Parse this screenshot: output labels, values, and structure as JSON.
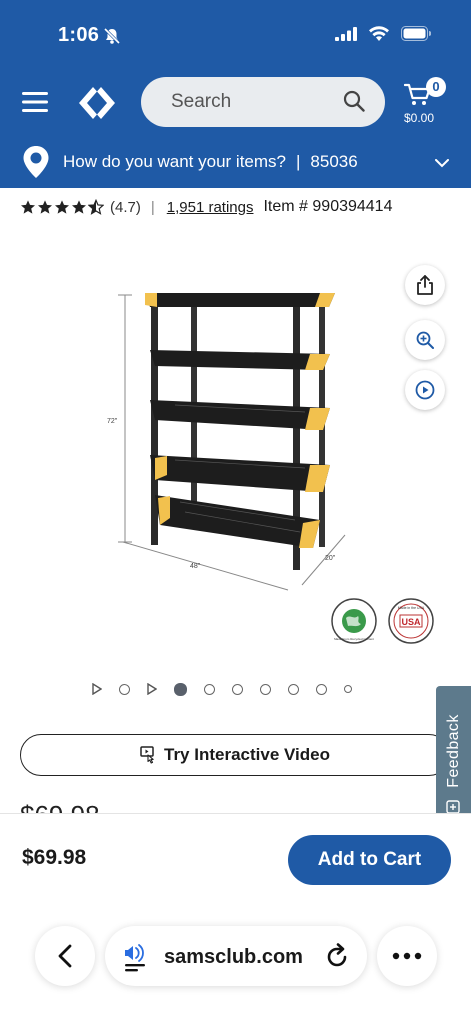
{
  "status_bar": {
    "time": "1:06"
  },
  "header": {
    "search_placeholder": "Search",
    "cart_count": "0",
    "cart_total": "$0.00",
    "delivery_prompt": "How do you want your items?",
    "delivery_separator": "|",
    "zip": "85036"
  },
  "product": {
    "rating_value": "(4.7)",
    "rating_stars": 4.7,
    "ratings_divider": "|",
    "ratings_count": "1,951 ratings",
    "item_number": "Item # 990394414",
    "image_dim_height": "72\"",
    "image_dim_width": "48\"",
    "image_dim_depth": "20\"",
    "seal_recycled": "Made From Recycled Content",
    "seal_usa": "Made in the USA",
    "seal_usa_text": "USA",
    "price_cut": "$69.98",
    "interactive_video_label": "Try Interactive Video"
  },
  "gallery": {
    "total_dots": 10,
    "active_index": 3
  },
  "feedback": {
    "label": "Feedback"
  },
  "bottom_bar": {
    "price": "$69.98",
    "add_to_cart_label": "Add to Cart"
  },
  "browser": {
    "url": "samsclub.com"
  },
  "colors": {
    "brand_blue": "#1f5aa6",
    "feedback_bg": "#5d7a8c",
    "shelf_yellow": "#f2c14e"
  }
}
